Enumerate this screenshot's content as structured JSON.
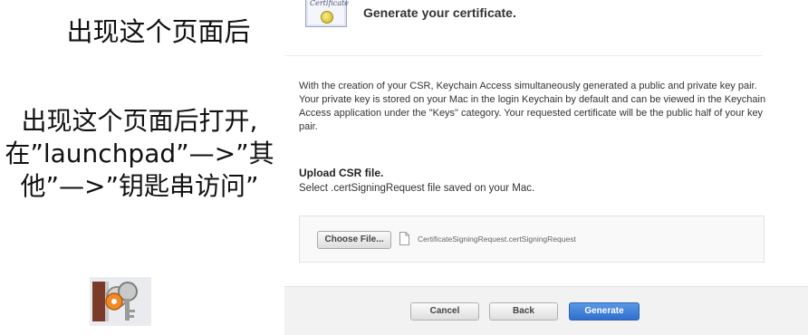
{
  "annotation": {
    "title": "出现这个页面后",
    "body": "出现这个页面后打开,在”launchpad”—>”其他”—>”钥匙串访问”",
    "icon": "keychain-access-icon"
  },
  "certificate": {
    "badge_text": "Certificate",
    "heading": "Generate your certificate.",
    "description": "With the creation of your CSR, Keychain Access simultaneously generated a public and private key pair. Your private key is stored on your Mac in the login Keychain by default and can be viewed in the Keychain Access application under the \"Keys\" category. Your requested certificate will be the public half of your key pair.",
    "upload_heading": "Upload CSR file.",
    "upload_sub": "Select .certSigningRequest file saved on your Mac.",
    "choose_label": "Choose File...",
    "file_name": "CertificateSigningRequest.certSigningRequest"
  },
  "footer": {
    "cancel_label": "Cancel",
    "back_label": "Back",
    "generate_label": "Generate"
  },
  "colors": {
    "primary_button": "#3b7bd6",
    "panel_background": "#ffffff",
    "footer_background": "#f2f2f2"
  }
}
